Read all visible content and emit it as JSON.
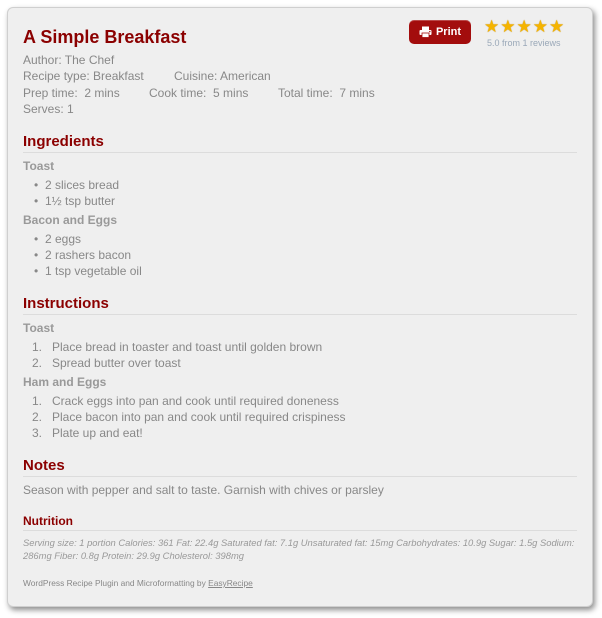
{
  "recipe": {
    "title": "A Simple Breakfast",
    "author": "Author: The Chef",
    "recipe_type": "Recipe type: Breakfast",
    "cuisine": "Cuisine: American",
    "prep": "Prep time:  2 mins",
    "cook": "Cook time:  5 mins",
    "total": "Total time:  7 mins",
    "serves": "Serves: 1"
  },
  "print_button": {
    "label": "Print",
    "icon": "printer-icon"
  },
  "rating": {
    "stars": 5,
    "max": 5,
    "text": "5.0 from 1 reviews",
    "color": "#f5b400"
  },
  "ingredients": {
    "heading": "Ingredients",
    "groups": [
      {
        "name": "Toast",
        "items": [
          "2 slices bread",
          "1½ tsp butter"
        ]
      },
      {
        "name": "Bacon and Eggs",
        "items": [
          "2 eggs",
          "2 rashers bacon",
          "1 tsp vegetable oil"
        ]
      }
    ]
  },
  "instructions": {
    "heading": "Instructions",
    "groups": [
      {
        "name": "Toast",
        "steps": [
          "Place bread in toaster and toast until golden brown",
          "Spread butter over toast"
        ]
      },
      {
        "name": "Ham and Eggs",
        "steps": [
          "Crack eggs into pan and cook until required doneness",
          "Place bacon into pan and cook until required crispiness",
          "Plate up and eat!"
        ]
      }
    ]
  },
  "notes": {
    "heading": "Notes",
    "text": "Season with pepper and salt to taste. Garnish with chives or parsley"
  },
  "nutrition": {
    "heading": "Nutrition",
    "text": "Serving size: 1 portion Calories: 361 Fat: 22.4g Saturated fat: 7.1g Unsaturated fat: 15mg Carbohydrates: 10.9g Sugar: 1.5g Sodium: 286mg Fiber: 0.8g Protein: 29.9g Cholesterol: 398mg"
  },
  "footer": {
    "text": "WordPress Recipe Plugin and Microformatting by ",
    "link": "EasyRecipe"
  },
  "colors": {
    "accent": "#8b0000",
    "button": "#a30d0d"
  }
}
